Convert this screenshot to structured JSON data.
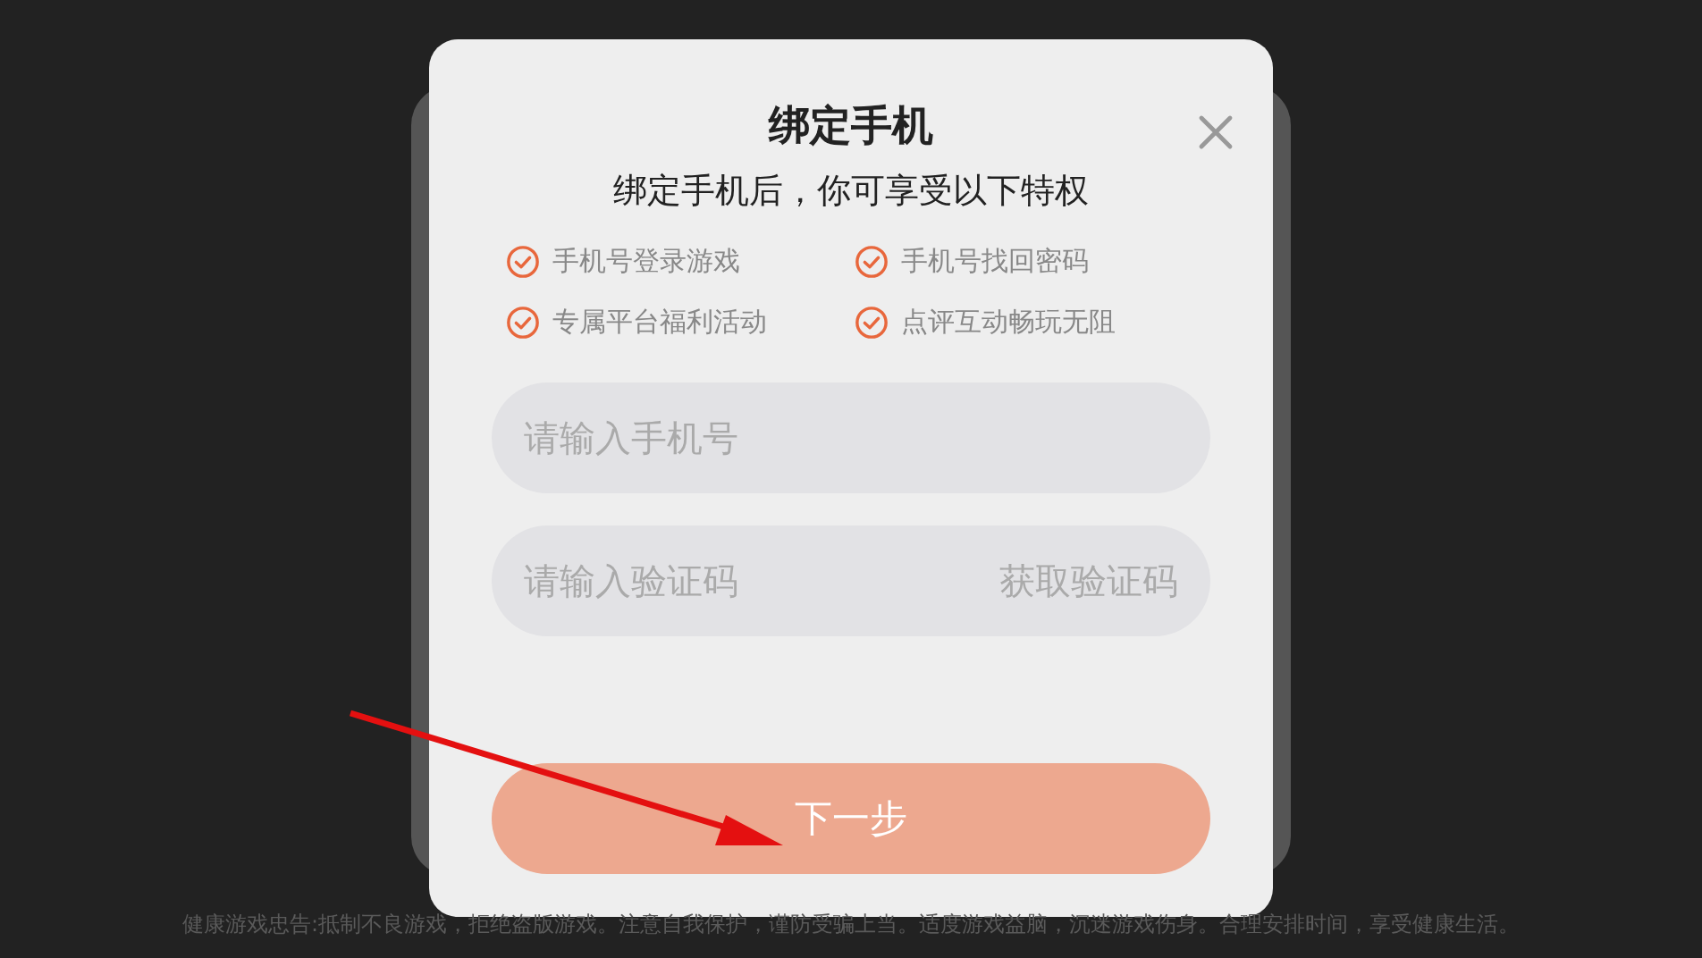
{
  "dialog": {
    "title": "绑定手机",
    "subtitle": "绑定手机后，你可享受以下特权",
    "benefits": [
      {
        "label": "手机号登录游戏"
      },
      {
        "label": "手机号找回密码"
      },
      {
        "label": "专属平台福利活动"
      },
      {
        "label": "点评互动畅玩无阻"
      }
    ],
    "phone_field": {
      "placeholder": "请输入手机号"
    },
    "code_field": {
      "placeholder": "请输入验证码"
    },
    "get_code_button": "获取验证码",
    "next_button": "下一步"
  },
  "footer_notice": "健康游戏忠告:抵制不良游戏，拒绝盗版游戏。注意自我保护，谨防受骗上当。适度游戏益脑，沉迷游戏伤身。合理安排时间，享受健康生活。"
}
